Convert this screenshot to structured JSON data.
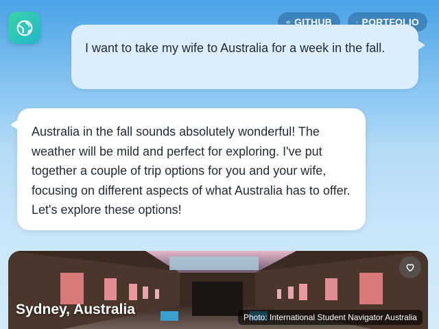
{
  "header": {
    "logo_icon": "globe-icon",
    "links": [
      {
        "label": "GITHUB",
        "icon": "code-icon"
      },
      {
        "label": "PORTFOLIO",
        "icon": "external-link-icon"
      }
    ]
  },
  "messages": [
    {
      "role": "user",
      "text": "I want to take my wife to Australia for a week in the fall."
    },
    {
      "role": "assistant",
      "text": "Australia in the fall sounds absolutely wonderful! The weather will be mild and perfect for exploring. I've put together a couple of trip options for you and your wife, focusing on different aspects of what Australia has to offer. Let's explore these options!"
    }
  ],
  "card": {
    "destination": "Sydney, Australia",
    "photo_credit": "Photo: International Student Navigator Australia",
    "favorite_icon": "heart-icon"
  },
  "colors": {
    "accent": "#2ec4b6",
    "user_bubble": "#dcedfb",
    "assistant_bubble": "#ffffff"
  }
}
